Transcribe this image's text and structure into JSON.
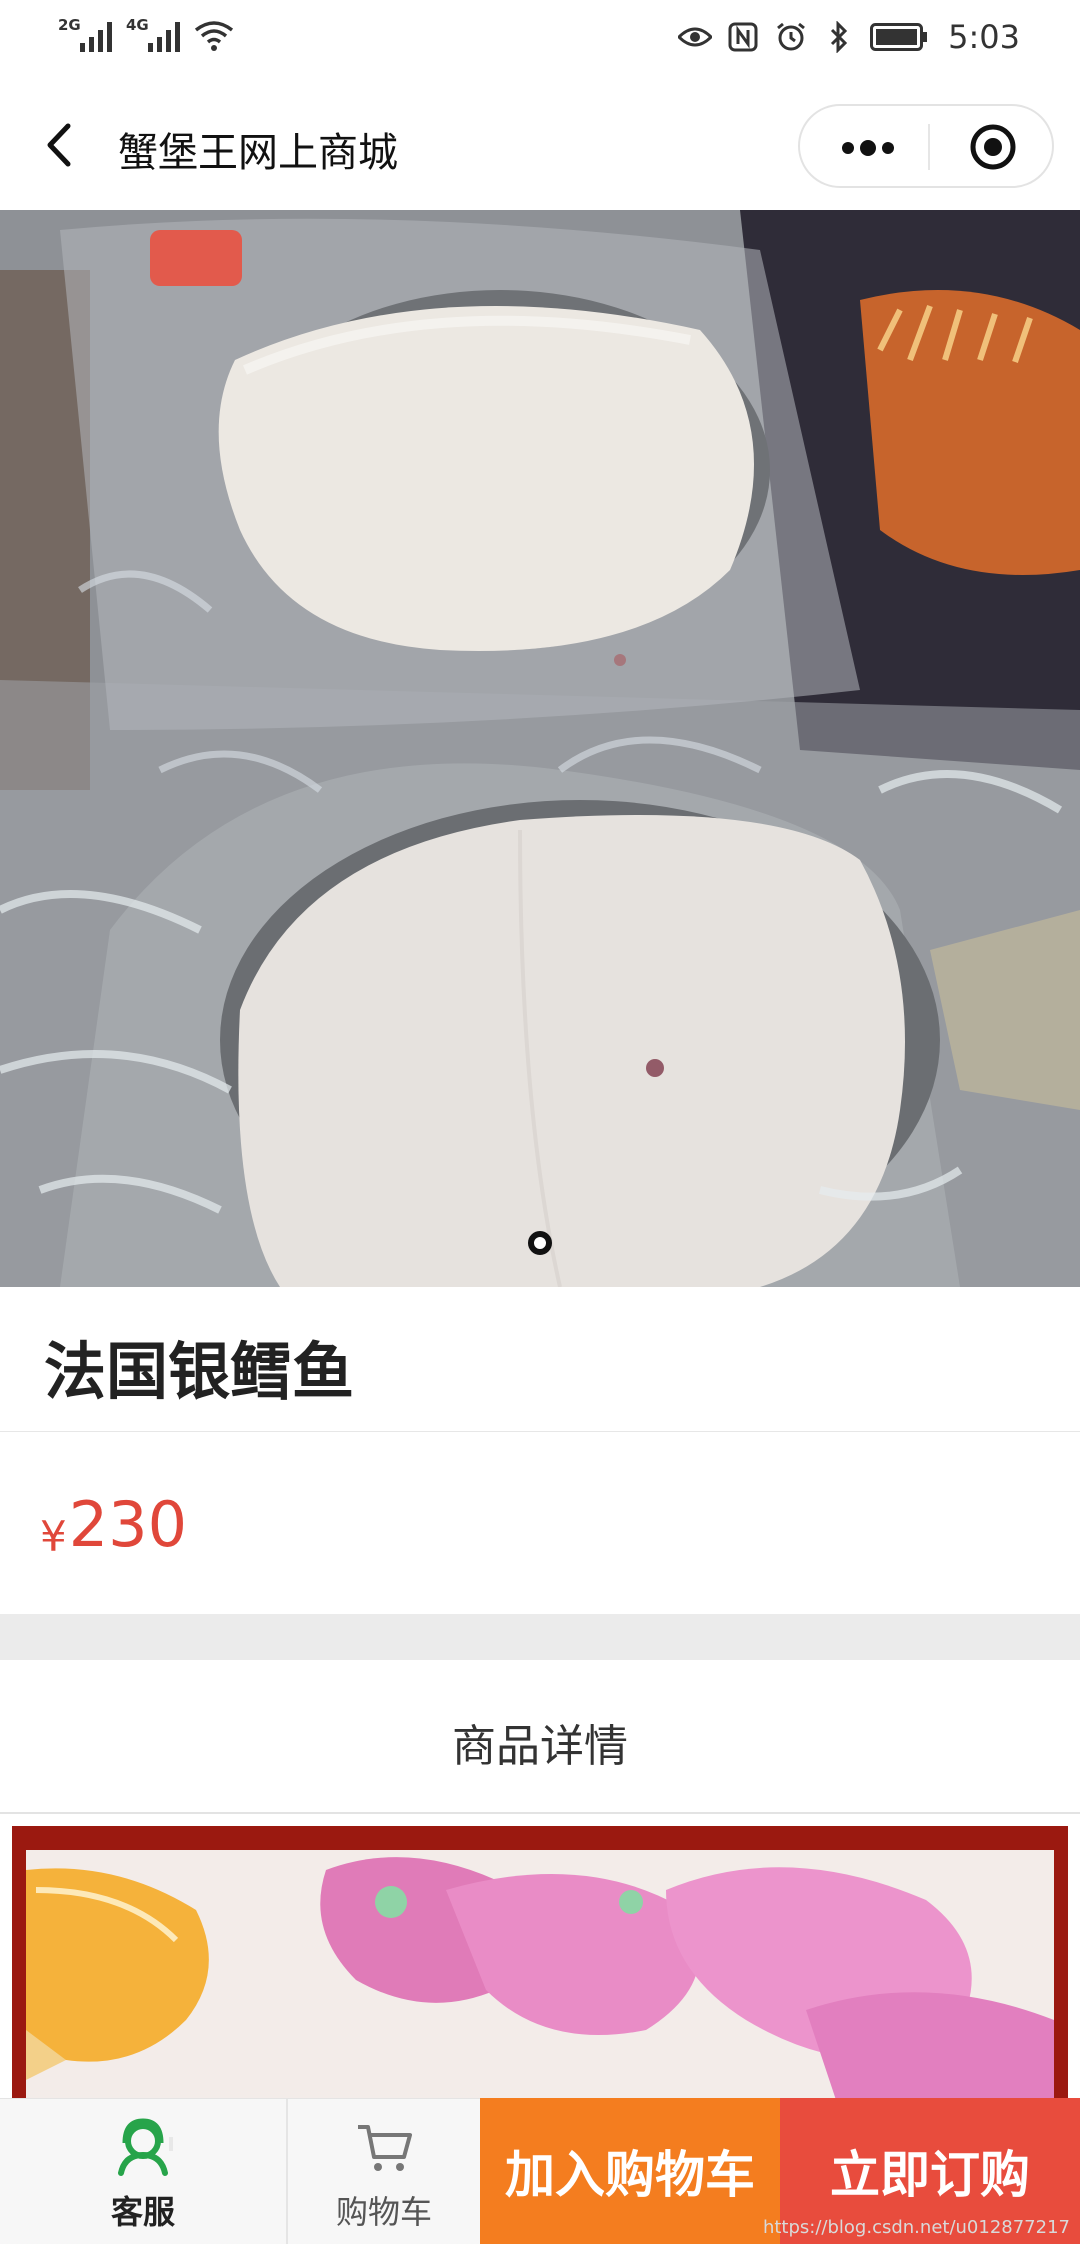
{
  "status_bar": {
    "signal_1_label": "2G",
    "signal_2_label": "4G",
    "time": "5:03",
    "icons": [
      "eye-icon",
      "nfc-icon",
      "alarm-icon",
      "bluetooth-icon",
      "battery-icon"
    ]
  },
  "nav": {
    "title": "蟹堡王网上商城",
    "back_icon": "chevron-left-icon",
    "more_icon": "more-dots-icon",
    "close_icon": "target-icon"
  },
  "hero": {
    "carousel_total": 1,
    "carousel_active": 1
  },
  "product": {
    "title": "法国银鳕鱼",
    "currency": "¥",
    "price": "230"
  },
  "detail": {
    "section_title": "商品详情"
  },
  "bottom_bar": {
    "service_label": "客服",
    "cart_label": "购物车",
    "add_to_cart_label": "加入购物车",
    "buy_now_label": "立即订购"
  },
  "watermark": "https://blog.csdn.net/u012877217",
  "colors": {
    "price": "#e0473a",
    "add_to_cart": "#f47d1f",
    "buy_now": "#e84c3d",
    "service_icon": "#27a44a"
  }
}
